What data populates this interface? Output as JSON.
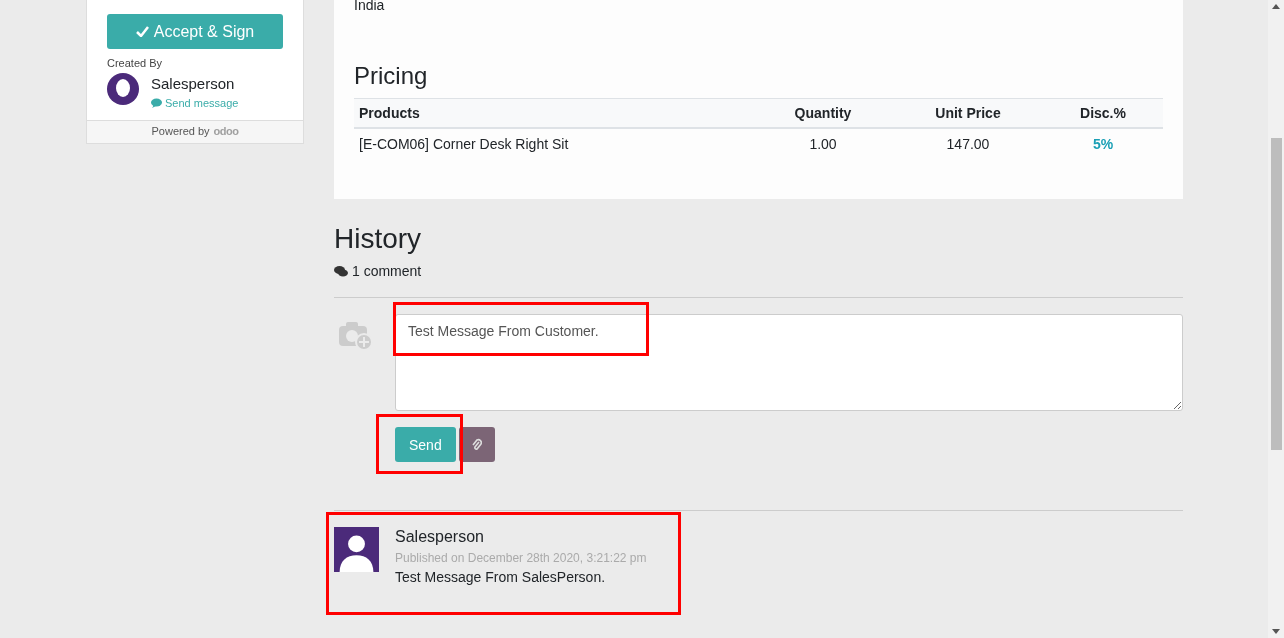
{
  "sidebar": {
    "accept_button": "Accept & Sign",
    "created_by_label": "Created By",
    "author": "Salesperson",
    "send_message_link": "Send message",
    "powered_by": "Powered by",
    "powered_logo": "odoo"
  },
  "address_tail": "India",
  "pricing": {
    "title": "Pricing",
    "columns": [
      "Products",
      "Quantity",
      "Unit Price",
      "Disc.%"
    ],
    "rows": [
      {
        "product": "[E-COM06] Corner Desk Right Sit",
        "quantity": "1.00",
        "unit_price": "147.00",
        "discount": "5%"
      }
    ]
  },
  "history": {
    "title": "History",
    "comment_count": "1 comment",
    "composer": {
      "value": "Test Message From Customer.",
      "send_button": "Send"
    },
    "messages": [
      {
        "author": "Salesperson",
        "published": "Published on December 28th 2020, 3:21:22 pm",
        "body": "Test Message From SalesPerson."
      }
    ]
  }
}
